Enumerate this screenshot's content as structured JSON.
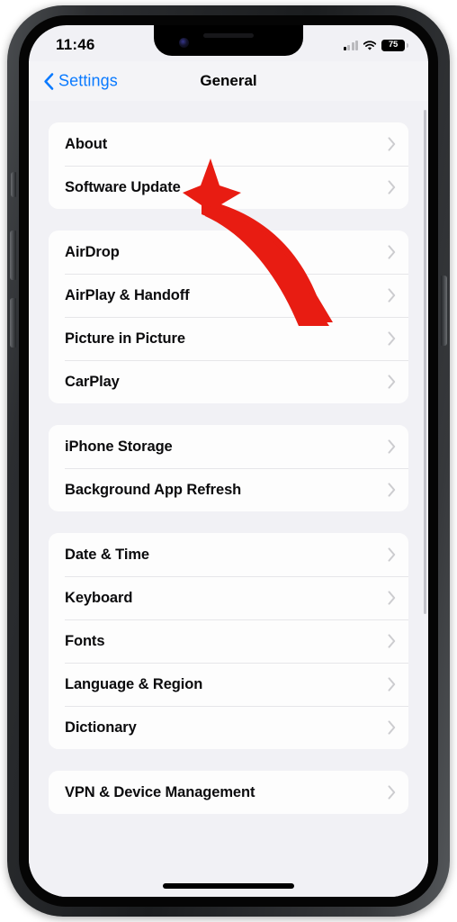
{
  "status_bar": {
    "time": "11:46",
    "battery_percent": "75",
    "signal_icon": "cellular-signal-icon",
    "wifi_icon": "wifi-icon",
    "battery_icon": "battery-icon",
    "signal_bars_active": 1,
    "signal_bars_total": 4
  },
  "nav": {
    "back_label": "Settings",
    "back_icon": "chevron-left-icon",
    "title": "General"
  },
  "colors": {
    "accent_blue": "#0A7AFF",
    "annotation_red": "#E81C12",
    "page_background": "#F1F1F5",
    "card_background": "#FDFDFD",
    "chevron_gray": "#C4C4C8"
  },
  "annotation": {
    "type": "curved-arrow",
    "color": "#E81C12",
    "points_to": "Software Update"
  },
  "groups": [
    {
      "id": "group-system-info",
      "rows": [
        {
          "label": "About",
          "chevron": "chevron-right-icon"
        },
        {
          "label": "Software Update",
          "chevron": "chevron-right-icon"
        }
      ]
    },
    {
      "id": "group-connectivity",
      "rows": [
        {
          "label": "AirDrop",
          "chevron": "chevron-right-icon"
        },
        {
          "label": "AirPlay & Handoff",
          "chevron": "chevron-right-icon"
        },
        {
          "label": "Picture in Picture",
          "chevron": "chevron-right-icon"
        },
        {
          "label": "CarPlay",
          "chevron": "chevron-right-icon"
        }
      ]
    },
    {
      "id": "group-storage",
      "rows": [
        {
          "label": "iPhone Storage",
          "chevron": "chevron-right-icon"
        },
        {
          "label": "Background App Refresh",
          "chevron": "chevron-right-icon"
        }
      ]
    },
    {
      "id": "group-localization",
      "rows": [
        {
          "label": "Date & Time",
          "chevron": "chevron-right-icon"
        },
        {
          "label": "Keyboard",
          "chevron": "chevron-right-icon"
        },
        {
          "label": "Fonts",
          "chevron": "chevron-right-icon"
        },
        {
          "label": "Language & Region",
          "chevron": "chevron-right-icon"
        },
        {
          "label": "Dictionary",
          "chevron": "chevron-right-icon"
        }
      ]
    },
    {
      "id": "group-management",
      "rows": [
        {
          "label": "VPN & Device Management",
          "chevron": "chevron-right-icon"
        }
      ]
    }
  ]
}
